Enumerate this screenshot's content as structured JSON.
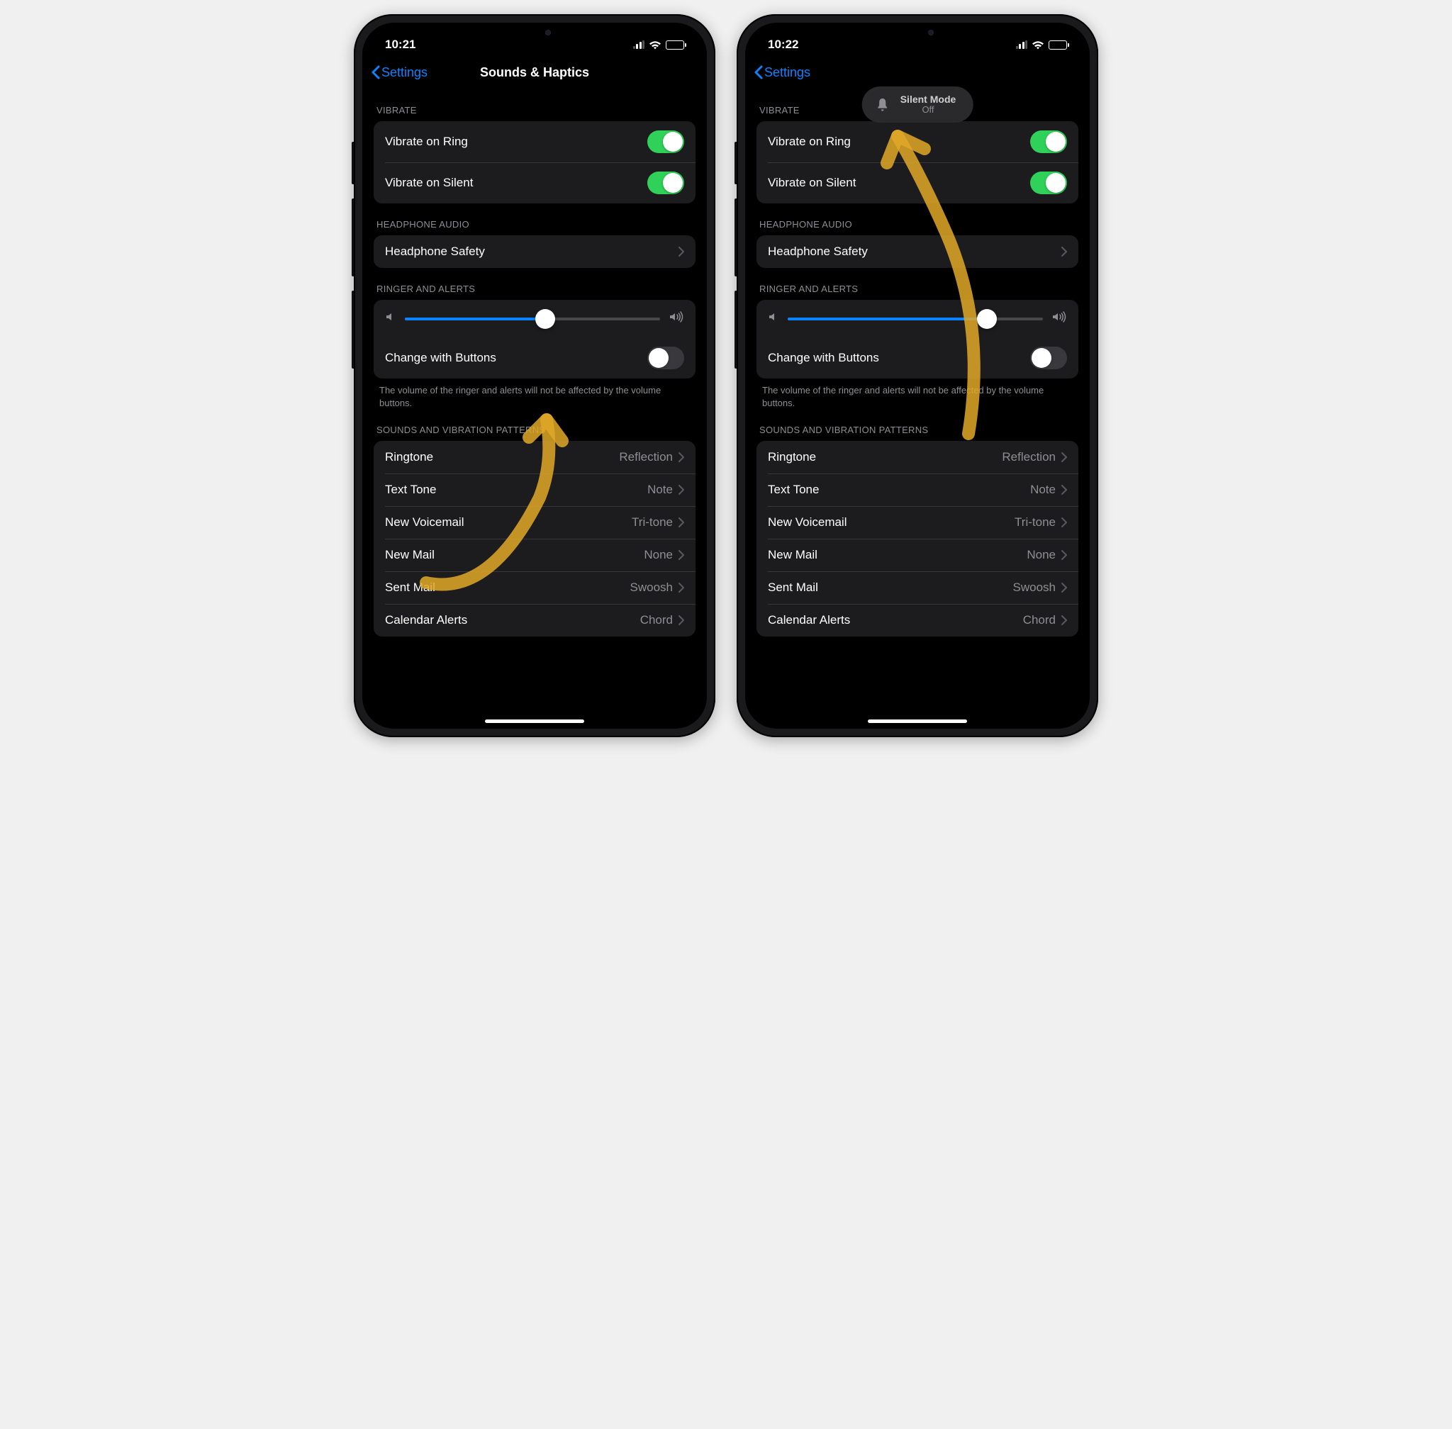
{
  "left": {
    "time": "10:21",
    "back": "Settings",
    "title": "Sounds & Haptics",
    "slider_pct": 55,
    "toast": null
  },
  "right": {
    "time": "10:22",
    "back": "Settings",
    "title": "",
    "slider_pct": 78,
    "toast": {
      "title": "Silent Mode",
      "sub": "Off"
    }
  },
  "sections": {
    "vibrate_header": "VIBRATE",
    "vibrate": [
      {
        "label": "Vibrate on Ring",
        "on": true
      },
      {
        "label": "Vibrate on Silent",
        "on": true
      }
    ],
    "headphone_header": "HEADPHONE AUDIO",
    "headphone_label": "Headphone Safety",
    "ringer_header": "RINGER AND ALERTS",
    "change_buttons_label": "Change with Buttons",
    "change_buttons_on": false,
    "ringer_footer": "The volume of the ringer and alerts will not be affected by the volume buttons.",
    "patterns_header": "SOUNDS AND VIBRATION PATTERNS",
    "patterns": [
      {
        "label": "Ringtone",
        "value": "Reflection"
      },
      {
        "label": "Text Tone",
        "value": "Note"
      },
      {
        "label": "New Voicemail",
        "value": "Tri-tone"
      },
      {
        "label": "New Mail",
        "value": "None"
      },
      {
        "label": "Sent Mail",
        "value": "Swoosh"
      },
      {
        "label": "Calendar Alerts",
        "value": "Chord"
      }
    ]
  },
  "status": {
    "signal_active": 2,
    "battery_pct": 95
  }
}
